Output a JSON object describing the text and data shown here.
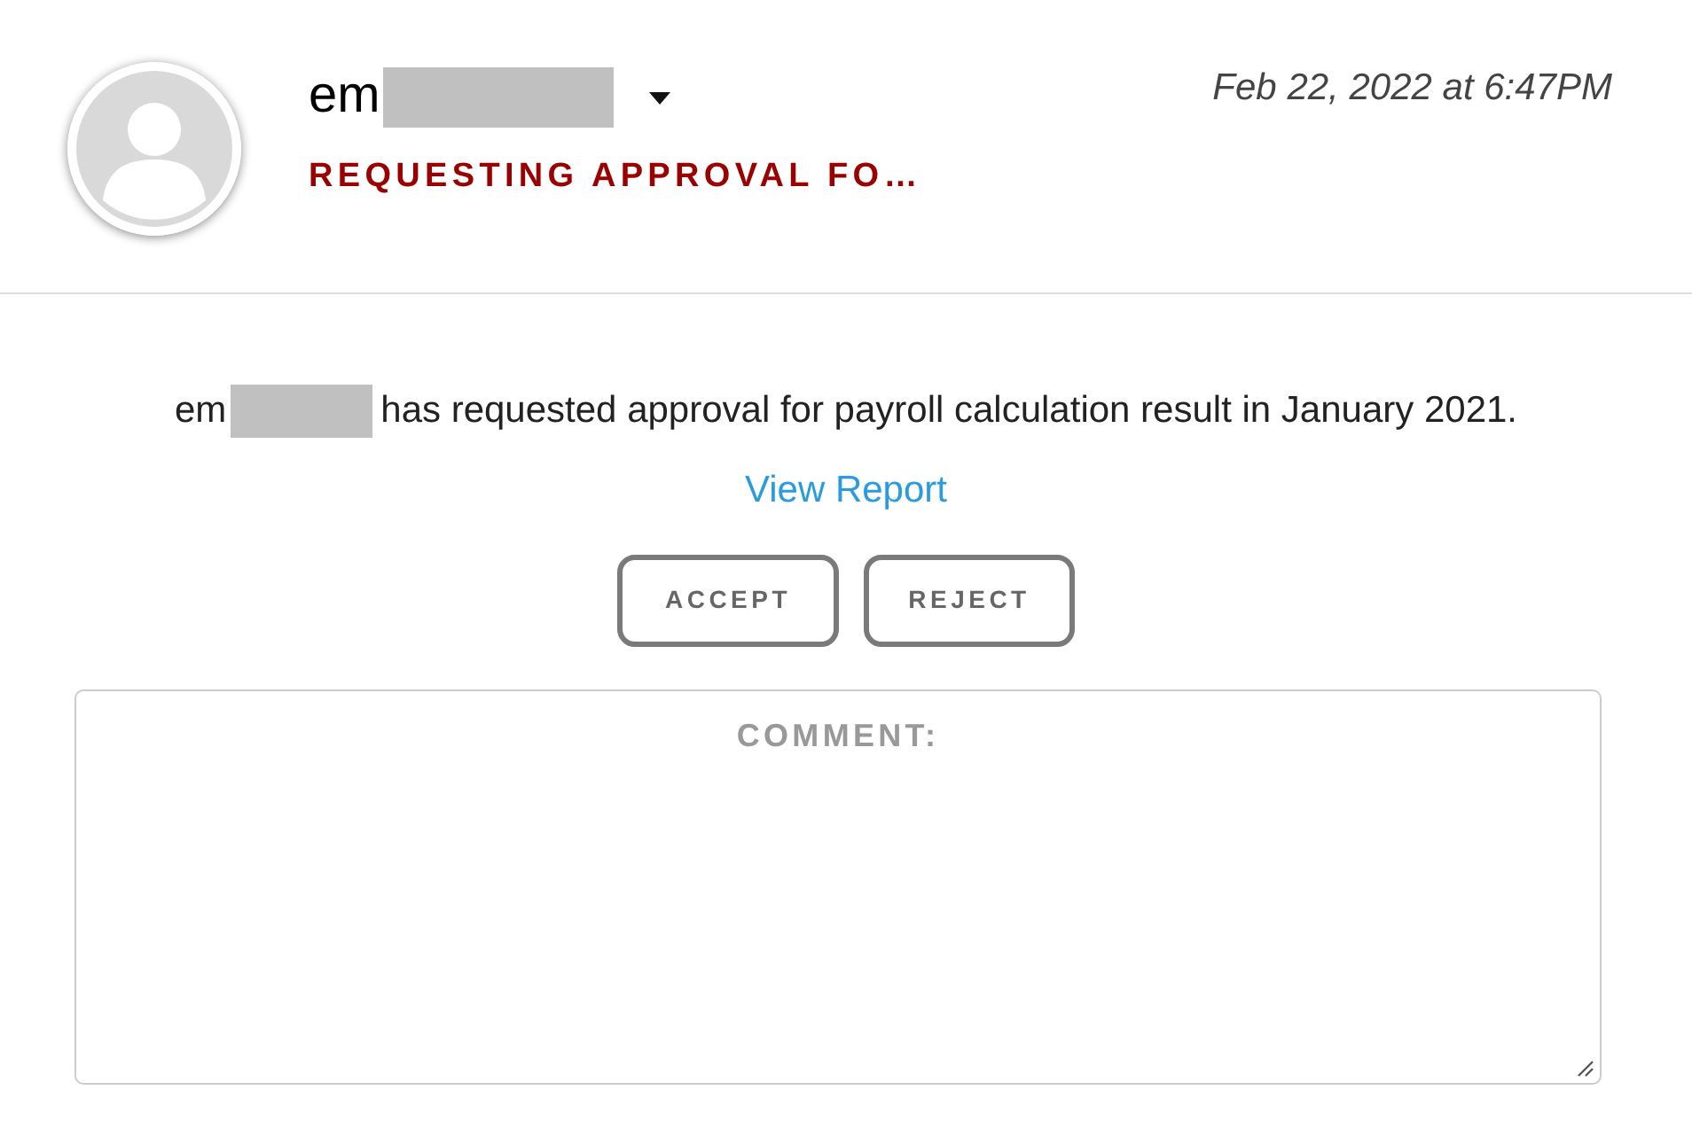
{
  "header": {
    "name": "em",
    "title": "REQUESTING APPROVAL FO…",
    "timestamp": "Feb 22, 2022 at 6:47PM"
  },
  "message": {
    "name": "em",
    "text": "has requested approval for payroll calculation result in January 2021.",
    "link": "View Report"
  },
  "buttons": [
    "ACCEPT",
    "REJECT"
  ],
  "comment": {
    "label": "COMMENT:"
  }
}
